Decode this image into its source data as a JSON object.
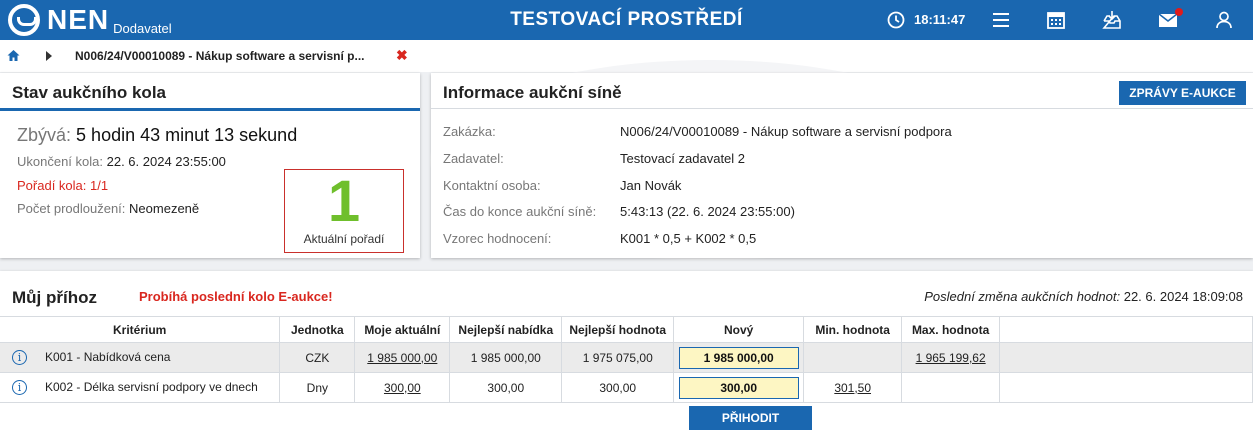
{
  "header": {
    "logo_text": "NEN",
    "logo_sub": "Dodavatel",
    "env_title": "TESTOVACÍ PROSTŘEDÍ",
    "time": "18:11:47",
    "icons": [
      "clock-icon",
      "menu-icon",
      "calendar-icon",
      "inbox-icon",
      "mail-icon",
      "user-icon"
    ],
    "notification_color": "#e01b1b",
    "brand_color": "#1a67b0"
  },
  "breadcrumb": {
    "path": "N006/24/V00010089 - Nákup software a servisní p...",
    "close": "✖"
  },
  "round": {
    "title": "Stav aukčního kola",
    "remaining_label": "Zbývá:",
    "remaining_value": "5 hodin 43 minut 13 sekund",
    "end_label": "Ukončení kola:",
    "end_value": "22. 6. 2024 23:55:00",
    "order_text": "Pořadí kola: 1/1",
    "ext_label": "Počet prodloužení:",
    "ext_value": "Neomezeně",
    "rank_value": "1",
    "rank_label": "Aktuální pořadí"
  },
  "info": {
    "title": "Informace aukční síně",
    "messages_button": "ZPRÁVY E-AUKCE",
    "rows": [
      {
        "label": "Zakázka:",
        "value": "N006/24/V00010089 - Nákup software a servisní podpora"
      },
      {
        "label": "Zadavatel:",
        "value": "Testovací zadavatel 2"
      },
      {
        "label": "Kontaktní osoba:",
        "value": "Jan Novák"
      },
      {
        "label": "Čas do konce aukční síně:",
        "value": "5:43:13 (22. 6. 2024 23:55:00)"
      },
      {
        "label": "Vzorec hodnocení:",
        "value": "K001 * 0,5 + K002 * 0,5"
      }
    ]
  },
  "bid": {
    "title": "Můj příhoz",
    "warning": "Probíhá poslední kolo E-aukce!",
    "last_change_label": "Poslední změna aukčních hodnot:",
    "last_change_value": "22. 6. 2024 18:09:08",
    "columns": [
      "Kritérium",
      "Jednotka",
      "Moje aktuální",
      "Nejlepší nabídka",
      "Nejlepší hodnota",
      "Nový",
      "Min. hodnota",
      "Max. hodnota"
    ],
    "rows": [
      {
        "criterion": "K001 - Nabídková cena",
        "unit": "CZK",
        "current": "1 985 000,00",
        "best_offer": "1 985 000,00",
        "best_value": "1 975 075,00",
        "new": "1 985 000,00",
        "min": "",
        "max": "1 965 199,62"
      },
      {
        "criterion": "K002 - Délka servisní podpory ve dnech",
        "unit": "Dny",
        "current": "300,00",
        "best_offer": "300,00",
        "best_value": "300,00",
        "new": "300,00",
        "min": "301,50",
        "max": ""
      }
    ],
    "submit_button": "PŘIHODIT"
  }
}
